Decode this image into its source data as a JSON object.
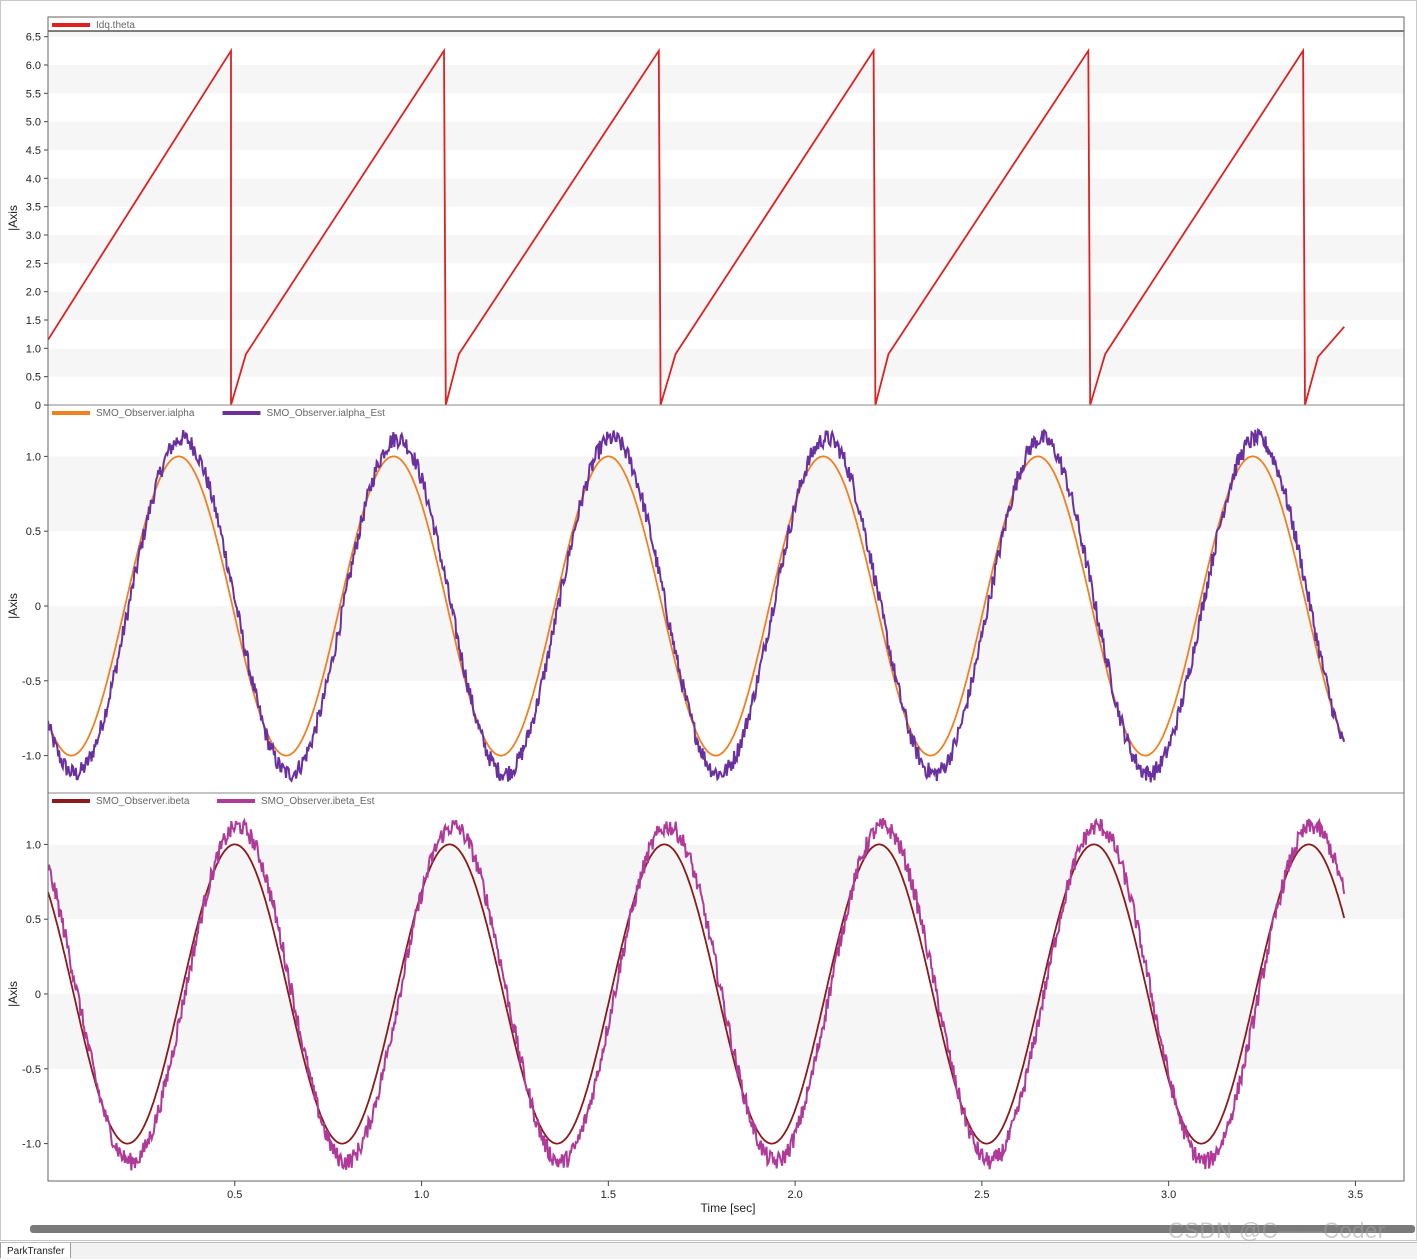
{
  "tab": {
    "label": "ParkTransfer"
  },
  "watermark": {
    "text": "CSDN @C——Coder"
  },
  "chart_data": {
    "type": "line",
    "xlabel": "Time [sec]",
    "x_ticks": [
      "0.5",
      "1.0",
      "1.5",
      "2.0",
      "2.5",
      "3.0",
      "3.5"
    ],
    "x_tick_values": [
      0.5,
      1.0,
      1.5,
      2.0,
      2.5,
      3.0,
      3.5
    ],
    "xlim": [
      0.0,
      3.63
    ],
    "grid": "horizontal bands",
    "legend_position": "top-left",
    "panels": [
      {
        "ylabel": "|Axis",
        "ylim": [
          0,
          6.6
        ],
        "y_ticks": [
          "0",
          "0.5",
          "1.0",
          "1.5",
          "2.0",
          "2.5",
          "3.0",
          "3.5",
          "4.0",
          "4.5",
          "5.0",
          "5.5",
          "6.0",
          "6.5"
        ],
        "y_tick_values": [
          0,
          0.5,
          1.0,
          1.5,
          2.0,
          2.5,
          3.0,
          3.5,
          4.0,
          4.5,
          5.0,
          5.5,
          6.0,
          6.5
        ],
        "series": [
          {
            "name": "Idq.theta",
            "color": "#e02020",
            "x": [
              0.0,
              0.49,
              0.49,
              0.53,
              1.06,
              1.065,
              1.1,
              1.635,
              1.64,
              1.68,
              2.21,
              2.215,
              2.25,
              2.785,
              2.79,
              2.83,
              3.36,
              3.365,
              3.4,
              3.47
            ],
            "y": [
              1.15,
              6.25,
              0.0,
              0.9,
              6.25,
              0.0,
              0.9,
              6.25,
              0.0,
              0.9,
              6.25,
              0.0,
              0.9,
              6.25,
              0.0,
              0.9,
              6.25,
              0.0,
              0.85,
              1.38
            ]
          }
        ]
      },
      {
        "ylabel": "|Axis",
        "ylim": [
          -1.25,
          1.25
        ],
        "y_ticks": [
          "-1.0",
          "-0.5",
          "0",
          "0.5",
          "1.0"
        ],
        "y_tick_values": [
          -1.0,
          -0.5,
          0,
          0.5,
          1.0
        ],
        "series": [
          {
            "name": "SMO_Observer.ialpha",
            "color": "#f08020",
            "amplitude": 1.0,
            "period": 0.575,
            "phase_offset": 0.0
          },
          {
            "name": "SMO_Observer.ialpha_Est",
            "color": "#6a30a0",
            "amplitude": 1.12,
            "period": 0.575,
            "phase_offset": 0.01,
            "noise": 0.06
          }
        ]
      },
      {
        "ylabel": "|Axis",
        "ylim": [
          -1.25,
          1.25
        ],
        "y_ticks": [
          "-1.0",
          "-0.5",
          "0",
          "0.5",
          "1.0"
        ],
        "y_tick_values": [
          -1.0,
          -0.5,
          0,
          0.5,
          1.0
        ],
        "series": [
          {
            "name": "SMO_Observer.ibeta",
            "color": "#8b1a1a",
            "amplitude": 1.0,
            "period": 0.575,
            "phase_offset": 0.0
          },
          {
            "name": "SMO_Observer.ibeta_Est",
            "color": "#b03a9a",
            "amplitude": 1.12,
            "period": 0.575,
            "phase_offset": 0.01,
            "noise": 0.06
          }
        ]
      }
    ],
    "x_end": 3.47
  }
}
